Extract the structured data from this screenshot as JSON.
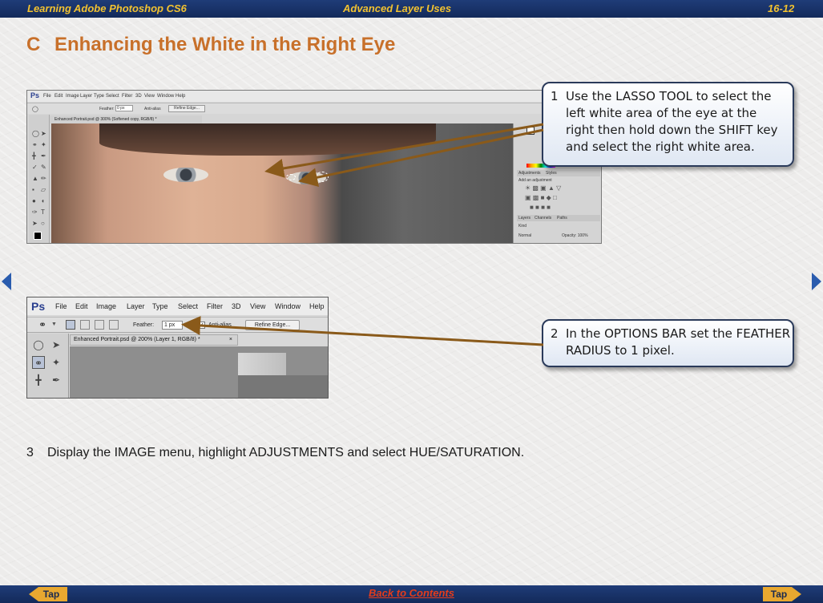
{
  "header": {
    "left": "Learning Adobe Photoshop CS6",
    "center": "Advanced Layer Uses",
    "right": "16-12"
  },
  "section": {
    "letter": "C",
    "title": "Enhancing the White in the Right Eye"
  },
  "screenshot1": {
    "logo": "Ps",
    "menus": [
      "File",
      "Edit",
      "Image",
      "Layer",
      "Type",
      "Select",
      "Filter",
      "3D",
      "View",
      "Window",
      "Help"
    ],
    "feather_label": "Feather:",
    "feather_value": "0 px",
    "antialias_label": "Anti-alias",
    "refine_label": "Refine Edge...",
    "doc_tab": "Enhanced Portrait.psd @ 300% (Softened copy, RGB/8) *",
    "panel_adjustments": "Adjustments",
    "panel_styles": "Styles",
    "panel_add": "Add an adjustment",
    "panel_layers": "Layers",
    "panel_channels": "Channels",
    "panel_paths": "Paths",
    "panel_kind": "Kind",
    "panel_blend": "Normal",
    "panel_opacity": "Opacity: 100%"
  },
  "screenshot2": {
    "logo": "Ps",
    "menus": [
      "File",
      "Edit",
      "Image",
      "Layer",
      "Type",
      "Select",
      "Filter",
      "3D",
      "View",
      "Window",
      "Help"
    ],
    "feather_label": "Feather:",
    "feather_value": "1 px",
    "antialias_label": "Anti-alias",
    "refine_label": "Refine Edge...",
    "doc_tab": "Enhanced Portrait.psd @ 200% (Layer 1, RGB/8) *"
  },
  "steps": [
    {
      "num": "1",
      "text": "Use the LASSO TOOL to select the left white area of the eye at the right then hold down the SHIFT key and select the right white area."
    },
    {
      "num": "2",
      "text": "In the OPTIONS BAR set the FEATHER RADIUS to 1 pixel."
    },
    {
      "num": "3",
      "text": "Display the IMAGE menu, highlight ADJUSTMENTS and select HUE/SATURATION."
    }
  ],
  "footer": {
    "tap_left": "Tap",
    "back": "Back to Contents",
    "tap_right": "Tap"
  },
  "colors": {
    "bar": "#1f3c78",
    "header_text": "#f2c230",
    "title": "#c8702a",
    "arrow": "#8a5a1a",
    "link": "#e43c1c"
  }
}
